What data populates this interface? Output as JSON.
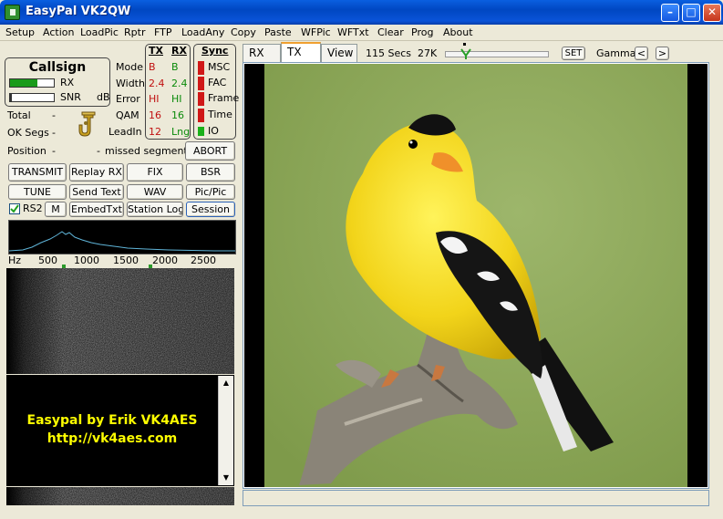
{
  "window": {
    "title": "EasyPal  VK2QW"
  },
  "menu": [
    "Setup",
    "Action",
    "LoadPic",
    "Rptr",
    "FTP",
    "LoadAny",
    "Copy",
    "Paste",
    "WFPic",
    "WFTxt",
    "Clear",
    "Prog",
    "About"
  ],
  "callsign": {
    "label": "Callsign",
    "rx_label": "RX",
    "snr_label": "SNR",
    "snr_unit": "dB",
    "rx_level": 0.62,
    "snr_level": 0.05
  },
  "stats": {
    "total_label": "Total",
    "total_value": "-",
    "ok_segs_label": "OK Segs",
    "ok_segs_value": "-",
    "position_label": "Position",
    "position_value": "-",
    "missed_value": "-",
    "missed_label": "missed segments"
  },
  "params": {
    "tx_header": "TX",
    "rx_header": "RX",
    "rows": [
      {
        "label": "Mode",
        "tx": "B",
        "rx": "B"
      },
      {
        "label": "Width",
        "tx": "2.4",
        "rx": "2.4"
      },
      {
        "label": "Error",
        "tx": "HI",
        "rx": "HI"
      },
      {
        "label": "QAM",
        "tx": "16",
        "rx": "16"
      },
      {
        "label": "LeadIn",
        "tx": "12",
        "rx": "Lng"
      }
    ]
  },
  "sync": {
    "header": "Sync",
    "items": [
      "MSC",
      "FAC",
      "Frame",
      "Time",
      "IO"
    ],
    "colors": {
      "off": "#d01818",
      "on": "#1ab01a"
    }
  },
  "buttons": {
    "abort": "ABORT",
    "transmit": "TRANSMIT",
    "replay_rx": "Replay RX",
    "fix": "FIX",
    "bsr": "BSR",
    "tune": "TUNE",
    "send_text": "Send Text",
    "wav": "WAV",
    "pic_pic": "Pic/Pic",
    "rs2": "RS2",
    "m": "M",
    "embed_txt": "EmbedTxt",
    "station_log": "Station Log",
    "session": "Session"
  },
  "spectrum": {
    "axis_unit": "Hz",
    "ticks": [
      "500",
      "1000",
      "1500",
      "2000",
      "2500"
    ]
  },
  "text_panel": {
    "line1": "Easypal by Erik VK4AES",
    "line2": "http://vk4aes.com"
  },
  "tabs": [
    "RX",
    "TX",
    "View"
  ],
  "toolbar": {
    "secs": "115 Secs",
    "size": "27K",
    "set_label": "SET",
    "gamma_label": "Gamma",
    "left_arrow": "<",
    "right_arrow": ">"
  }
}
